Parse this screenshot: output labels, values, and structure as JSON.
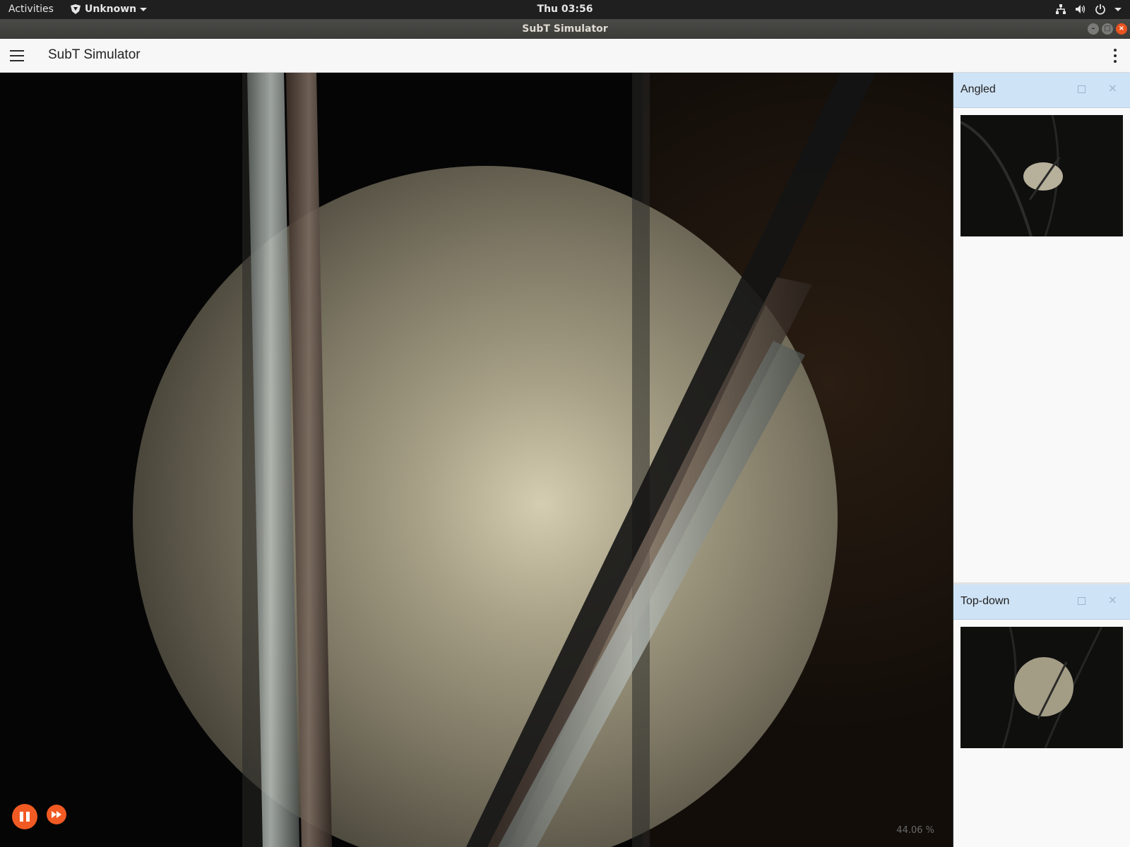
{
  "topbar": {
    "activities": "Activities",
    "app_menu": "Unknown",
    "clock": "Thu 03:56"
  },
  "window": {
    "title": "SubT Simulator"
  },
  "toolbar": {
    "title": "SubT Simulator"
  },
  "scene": {
    "stats_text": "44.06 %",
    "controls": {
      "pause_icon": "pause-icon",
      "step_icon": "fast-forward-icon",
      "accent": "#f25a23"
    }
  },
  "panels": [
    {
      "title": "Angled"
    },
    {
      "title": "Top-down"
    }
  ],
  "colors": {
    "panel_header": "#cfe3f6",
    "toolbar": "#f7f7f7",
    "close_button": "#e95420"
  }
}
